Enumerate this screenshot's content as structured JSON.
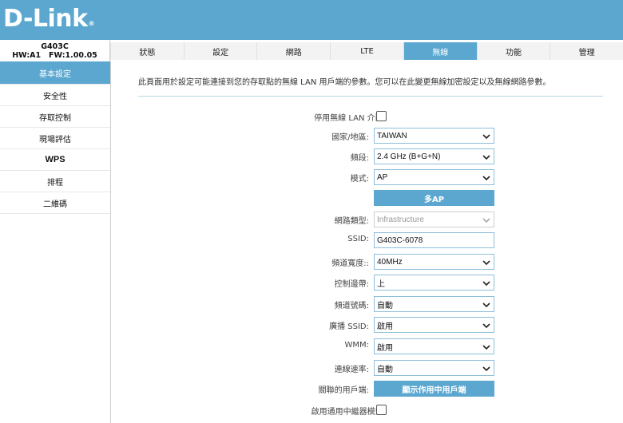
{
  "brand": {
    "logo_text": "D-Link",
    "registered_mark": "®"
  },
  "device": {
    "model": "G403C",
    "hw": "HW:A1",
    "fw": "FW:1.00.05"
  },
  "tabs": [
    "狀態",
    "設定",
    "網路",
    "LTE",
    "無線",
    "功能",
    "管理"
  ],
  "active_tab": "無線",
  "sidebar": {
    "items": [
      "基本設定",
      "安全性",
      "存取控制",
      "現場評估",
      "WPS",
      "排程",
      "二維碼"
    ],
    "active": "基本設定"
  },
  "main": {
    "description": "此頁面用於設定可能連接到您的存取點的無線 LAN 用戶端的參數。您可以在此變更無線加密設定以及無線網路參數。",
    "disable_wlan": {
      "label": "停用無線 LAN 介面:",
      "checked": false
    },
    "country": {
      "label": "國家/地區:",
      "value": "TAIWAN"
    },
    "band": {
      "label": "頻段:",
      "value": "2.4 GHz (B+G+N)"
    },
    "mode": {
      "label": "模式:",
      "value": "AP"
    },
    "multi_ap_button": "多AP",
    "network_type": {
      "label": "網路類型:",
      "value": "Infrastructure"
    },
    "ssid": {
      "label": "SSID:",
      "value": "G403C-6078"
    },
    "channel_width": {
      "label": "頻道寬度::",
      "value": "40MHz"
    },
    "control_sideband": {
      "label": "控制邊帶:",
      "value": "上"
    },
    "channel_number": {
      "label": "頻道號碼:",
      "value": "自動"
    },
    "broadcast_ssid": {
      "label": "廣播 SSID:",
      "value": "啟用"
    },
    "wmm": {
      "label": "WMM:",
      "value": "啟用"
    },
    "data_rate": {
      "label": "連線速率:",
      "value": "自動"
    },
    "associated_clients": {
      "label": "關聯的用戶端:",
      "button": "顯示作用中用戶端"
    },
    "universal_repeater": {
      "label": "啟用通用中繼器模式:",
      "checked": false
    }
  },
  "colors": {
    "accent": "#5ba7d0",
    "tab_bg": "#f3f3f3",
    "border": "#8fbfda"
  }
}
